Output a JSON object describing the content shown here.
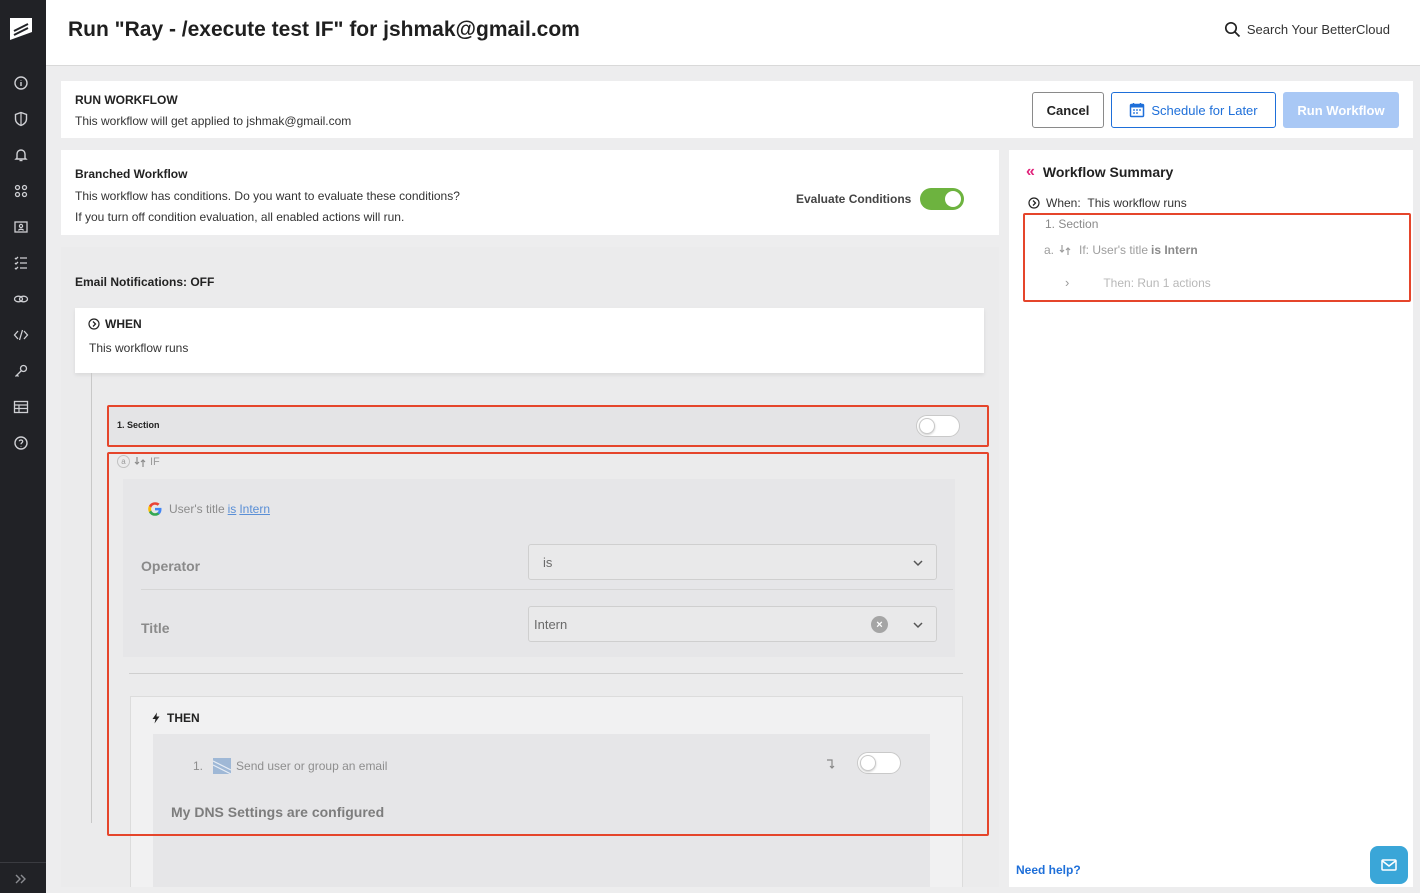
{
  "header": {
    "title": "Run \"Ray - /execute test IF\" for jshmak@gmail.com",
    "search_label": "Search Your BetterCloud"
  },
  "sidebar": {
    "items": [
      "info-icon",
      "shield-icon",
      "bell-icon",
      "apps-icon",
      "folder-user-icon",
      "list-check-icon",
      "link-icon",
      "code-icon",
      "key-icon",
      "table-icon",
      "help-icon"
    ]
  },
  "run_card": {
    "heading": "RUN WORKFLOW",
    "subtitle": "This workflow will get applied to jshmak@gmail.com",
    "cancel_label": "Cancel",
    "schedule_label": "Schedule for Later",
    "run_label": "Run Workflow"
  },
  "branch_card": {
    "heading": "Branched Workflow",
    "line1": "This workflow has conditions. Do you want to evaluate these conditions?",
    "line2": "If you turn off condition evaluation, all enabled actions will run.",
    "evaluate_label": "Evaluate Conditions",
    "evaluate_on": true
  },
  "workflow": {
    "email_notifications": "Email Notifications:  OFF",
    "when_heading": "WHEN",
    "when_text": "This workflow runs",
    "section_label": "1.   Section",
    "if_marker": "a",
    "if_label": "IF",
    "criteria_prefix": "User's title",
    "criteria_op": "is",
    "criteria_value": "Intern",
    "operator_label": "Operator",
    "operator_value": "is",
    "title_label": "Title",
    "title_value": "Intern",
    "then_label": "THEN",
    "action_number": "1.",
    "action_label": "Send user or group an email",
    "dns_label": "My DNS Settings are configured"
  },
  "summary": {
    "heading": "Workflow Summary",
    "when_prefix": "When:",
    "when_text": "This workflow runs",
    "section": "1. Section",
    "if_marker": "a.",
    "if_text": "If: User's title",
    "if_bold": "is Intern",
    "then_text": "Then: Run 1 actions",
    "help": "Need help?"
  },
  "colors": {
    "sidebar": "#212226",
    "accent": "#1e6fd9",
    "toggle_on": "#6db33f",
    "highlight": "#e5452b",
    "summary_chevron": "#e0227a"
  }
}
